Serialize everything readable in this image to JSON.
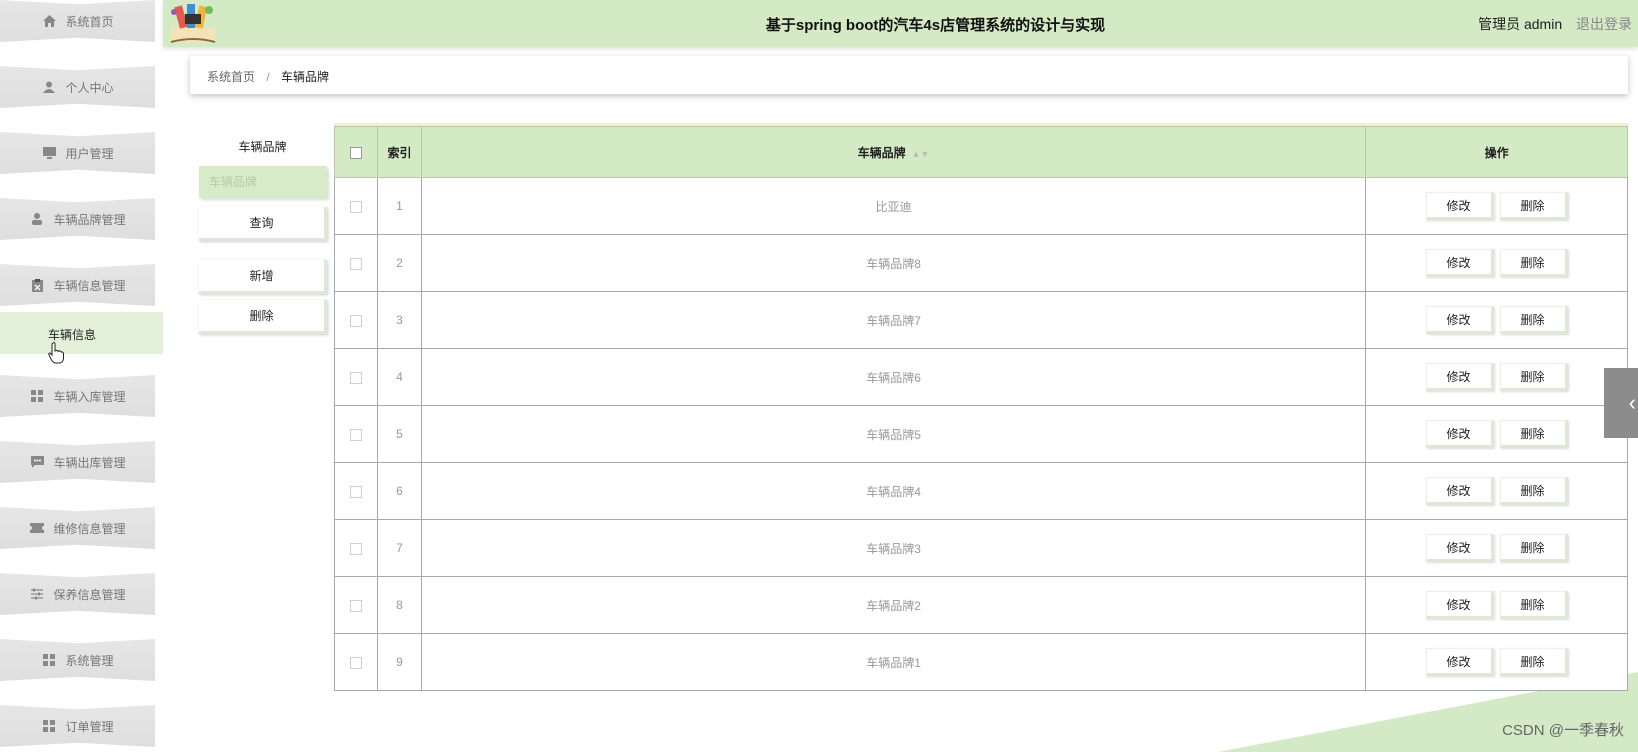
{
  "header": {
    "title": "基于spring boot的汽车4s店管理系统的设计与实现",
    "user_role": "管理员",
    "username": "admin",
    "logout_label": "退出登录"
  },
  "sidebar": {
    "items": [
      {
        "label": "系统首页",
        "icon": "home-icon"
      },
      {
        "label": "个人中心",
        "icon": "user-icon"
      },
      {
        "label": "用户管理",
        "icon": "monitor-icon"
      },
      {
        "label": "车辆品牌管理",
        "icon": "person-icon"
      },
      {
        "label": "车辆信息管理",
        "icon": "clipboard-icon"
      },
      {
        "label": "车辆入库管理",
        "icon": "grid-icon"
      },
      {
        "label": "车辆出库管理",
        "icon": "chat-icon"
      },
      {
        "label": "维修信息管理",
        "icon": "ticket-icon"
      },
      {
        "label": "保养信息管理",
        "icon": "sliders-icon"
      },
      {
        "label": "系统管理",
        "icon": "grid-icon"
      },
      {
        "label": "订单管理",
        "icon": "grid-icon"
      }
    ],
    "sub_item": "车辆信息"
  },
  "breadcrumb": {
    "home": "系统首页",
    "separator": "/",
    "current": "车辆品牌"
  },
  "form": {
    "label": "车辆品牌",
    "placeholder": "车辆品牌",
    "search_button": "查询",
    "add_button": "新增",
    "delete_button": "删除"
  },
  "table": {
    "columns": [
      "索引",
      "车辆品牌",
      "操作"
    ],
    "edit_label": "修改",
    "delete_label": "删除",
    "rows": [
      {
        "index": "1",
        "brand": "比亚迪"
      },
      {
        "index": "2",
        "brand": "车辆品牌8"
      },
      {
        "index": "3",
        "brand": "车辆品牌7"
      },
      {
        "index": "4",
        "brand": "车辆品牌6"
      },
      {
        "index": "5",
        "brand": "车辆品牌5"
      },
      {
        "index": "6",
        "brand": "车辆品牌4"
      },
      {
        "index": "7",
        "brand": "车辆品牌3"
      },
      {
        "index": "8",
        "brand": "车辆品牌2"
      },
      {
        "index": "9",
        "brand": "车辆品牌1"
      }
    ]
  },
  "watermark": "CSDN @一季春秋",
  "colors": {
    "accent": "#d4eac5",
    "sidebar_item": "#e3e3e3",
    "sub_item_active": "#e3f0d9"
  }
}
